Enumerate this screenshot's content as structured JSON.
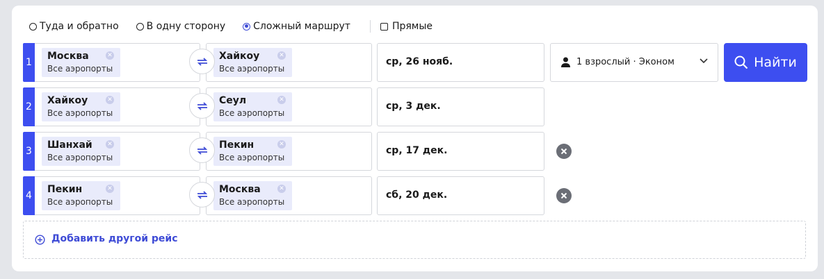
{
  "trip_types": [
    {
      "label": "Туда и обратно",
      "selected": false
    },
    {
      "label": "В одну сторону",
      "selected": false
    },
    {
      "label": "Сложный маршрут",
      "selected": true
    }
  ],
  "direct_label": "Прямые",
  "direct_checked": false,
  "legs": [
    {
      "num": "1",
      "from": {
        "city": "Москва",
        "airports": "Все аэропорты"
      },
      "to": {
        "city": "Хайкоу",
        "airports": "Все аэропорты"
      },
      "date": "ср, 26 нояб.",
      "removable": false
    },
    {
      "num": "2",
      "from": {
        "city": "Хайкоу",
        "airports": "Все аэропорты"
      },
      "to": {
        "city": "Сеул",
        "airports": "Все аэропорты"
      },
      "date": "ср, 3 дек.",
      "removable": false
    },
    {
      "num": "3",
      "from": {
        "city": "Шанхай",
        "airports": "Все аэропорты"
      },
      "to": {
        "city": "Пекин",
        "airports": "Все аэропорты"
      },
      "date": "ср, 17 дек.",
      "removable": true
    },
    {
      "num": "4",
      "from": {
        "city": "Пекин",
        "airports": "Все аэропорты"
      },
      "to": {
        "city": "Москва",
        "airports": "Все аэропорты"
      },
      "date": "сб, 20 дек.",
      "removable": true
    }
  ],
  "passengers": "1 взрослый · Эконом",
  "search_button": "Найти",
  "add_flight": "Добавить другой рейс",
  "colors": {
    "accent": "#3d4ef0",
    "chip": "#e9ebfb",
    "remove": "#6b6e76"
  }
}
